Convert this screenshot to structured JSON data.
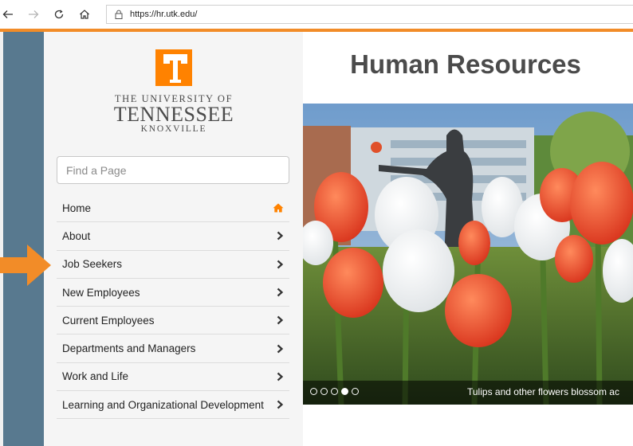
{
  "browser": {
    "url": "https://hr.utk.edu/",
    "icons": [
      "back-arrow-icon",
      "forward-arrow-icon",
      "refresh-icon",
      "home-icon",
      "lock-icon"
    ]
  },
  "colors": {
    "accent": "#ff8200",
    "browser_rule": "#f28c28",
    "strip": "#58798f",
    "sidebar_bg": "#f5f5f5",
    "text_gray": "#4b4b4b"
  },
  "university": {
    "line1": "THE UNIVERSITY OF",
    "line2": "TENNESSEE",
    "line3": "KNOXVILLE"
  },
  "search": {
    "placeholder": "Find a Page"
  },
  "menu": {
    "items": [
      {
        "label": "Home",
        "icon": "home-icon"
      },
      {
        "label": "About",
        "icon": "chevron-right-icon"
      },
      {
        "label": "Job Seekers",
        "icon": "chevron-right-icon"
      },
      {
        "label": "New Employees",
        "icon": "chevron-right-icon"
      },
      {
        "label": "Current Employees",
        "icon": "chevron-right-icon"
      },
      {
        "label": "Departments and Managers",
        "icon": "chevron-right-icon"
      },
      {
        "label": "Work and Life",
        "icon": "chevron-right-icon"
      },
      {
        "label": "Learning and Organizational Development",
        "icon": "chevron-right-icon"
      }
    ]
  },
  "main": {
    "title": "Human Resources",
    "carousel": {
      "caption": "Tulips and other flowers blossom ac",
      "slide_count": 5,
      "active_index": 3
    }
  }
}
